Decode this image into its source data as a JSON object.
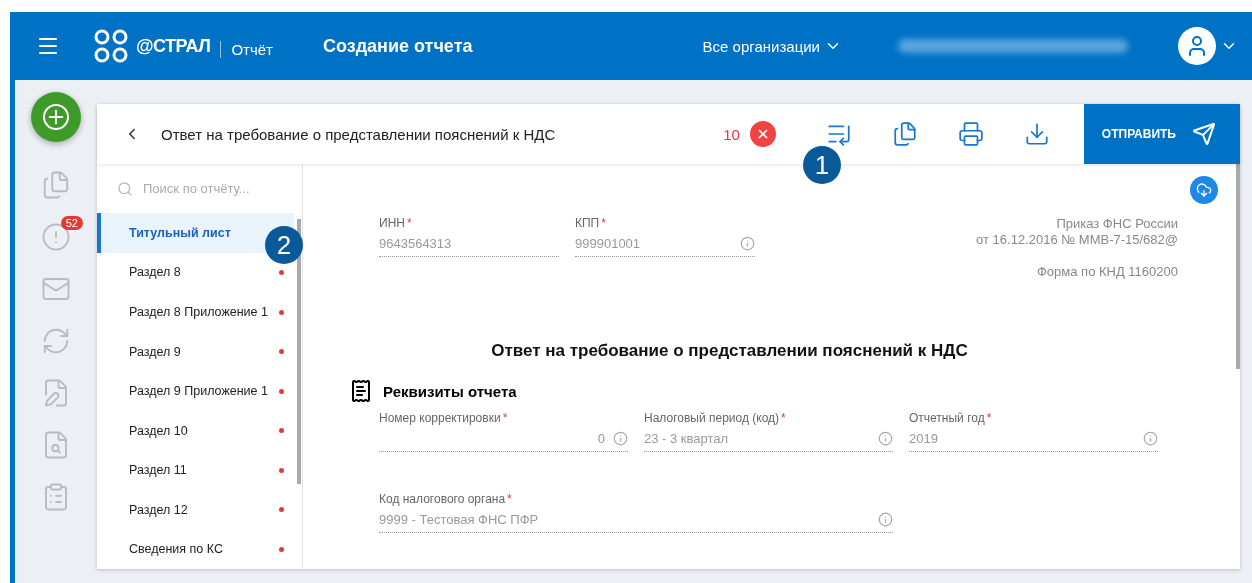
{
  "header": {
    "brand": "@СТРАЛ",
    "product": "Отчёт",
    "title": "Создание отчета",
    "organizations": "Все организации"
  },
  "rail": {
    "alerts_badge": "52"
  },
  "report": {
    "title": "Ответ на требование о представлении пояснений к НДС",
    "error_count": "10",
    "send_label": "ОТПРАВИТЬ"
  },
  "hints": [
    "1",
    "2"
  ],
  "sidebar": {
    "search_placeholder": "Поиск по отчёту...",
    "items": [
      {
        "label": "Титульный лист",
        "selected": true,
        "has_error": false
      },
      {
        "label": "Раздел 8",
        "selected": false,
        "has_error": true
      },
      {
        "label": "Раздел 8 Приложение 1",
        "selected": false,
        "has_error": true
      },
      {
        "label": "Раздел 9",
        "selected": false,
        "has_error": true
      },
      {
        "label": "Раздел 9 Приложение 1",
        "selected": false,
        "has_error": true
      },
      {
        "label": "Раздел 10",
        "selected": false,
        "has_error": true
      },
      {
        "label": "Раздел 11",
        "selected": false,
        "has_error": true
      },
      {
        "label": "Раздел 12",
        "selected": false,
        "has_error": true
      },
      {
        "label": "Сведения по КС",
        "selected": false,
        "has_error": true
      }
    ]
  },
  "form": {
    "top_fields": [
      {
        "label": "ИНН",
        "required_mark": "*",
        "value": "9643564313",
        "info": false
      },
      {
        "label": "КПП",
        "required_mark": "*",
        "value": "999901001",
        "info": true
      }
    ],
    "order_lines": [
      "Приказ ФНС России",
      "от 16.12.2016 № ММВ-7-15/682@",
      "Форма по КНД 1160200"
    ],
    "heading": "Ответ на требование о представлении пояснений к НДС",
    "section_title": "Реквизиты отчета",
    "fields": [
      {
        "label": "Номер корректировки",
        "required_mark": "*",
        "value": "0",
        "info": true,
        "right_aligned": true
      },
      {
        "label": "Налоговый период (код)",
        "required_mark": "*",
        "value": "23 - 3 квартал",
        "info": true,
        "right_aligned": false
      },
      {
        "label": "Отчетный год",
        "required_mark": "*",
        "value": "2019",
        "info": true,
        "right_aligned": false
      },
      {
        "label": "Код налогового органа",
        "required_mark": "*",
        "value": "9999 - Тестовая ФНС ПФР",
        "info": true,
        "right_aligned": false
      }
    ]
  }
}
